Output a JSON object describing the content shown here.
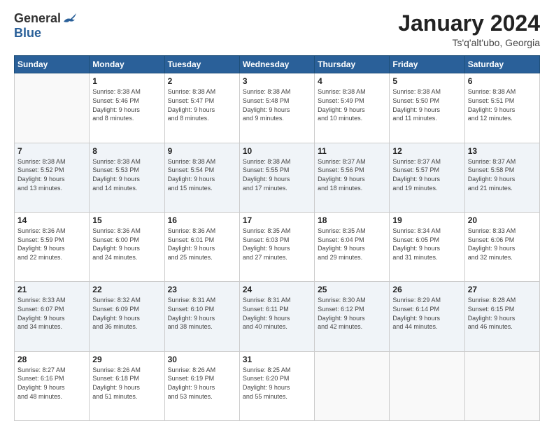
{
  "header": {
    "logo_general": "General",
    "logo_blue": "Blue",
    "month_title": "January 2024",
    "location": "Ts'q'alt'ubo, Georgia"
  },
  "weekdays": [
    "Sunday",
    "Monday",
    "Tuesday",
    "Wednesday",
    "Thursday",
    "Friday",
    "Saturday"
  ],
  "weeks": [
    [
      {
        "day": "",
        "info": ""
      },
      {
        "day": "1",
        "info": "Sunrise: 8:38 AM\nSunset: 5:46 PM\nDaylight: 9 hours\nand 8 minutes."
      },
      {
        "day": "2",
        "info": "Sunrise: 8:38 AM\nSunset: 5:47 PM\nDaylight: 9 hours\nand 8 minutes."
      },
      {
        "day": "3",
        "info": "Sunrise: 8:38 AM\nSunset: 5:48 PM\nDaylight: 9 hours\nand 9 minutes."
      },
      {
        "day": "4",
        "info": "Sunrise: 8:38 AM\nSunset: 5:49 PM\nDaylight: 9 hours\nand 10 minutes."
      },
      {
        "day": "5",
        "info": "Sunrise: 8:38 AM\nSunset: 5:50 PM\nDaylight: 9 hours\nand 11 minutes."
      },
      {
        "day": "6",
        "info": "Sunrise: 8:38 AM\nSunset: 5:51 PM\nDaylight: 9 hours\nand 12 minutes."
      }
    ],
    [
      {
        "day": "7",
        "info": "Sunrise: 8:38 AM\nSunset: 5:52 PM\nDaylight: 9 hours\nand 13 minutes."
      },
      {
        "day": "8",
        "info": "Sunrise: 8:38 AM\nSunset: 5:53 PM\nDaylight: 9 hours\nand 14 minutes."
      },
      {
        "day": "9",
        "info": "Sunrise: 8:38 AM\nSunset: 5:54 PM\nDaylight: 9 hours\nand 15 minutes."
      },
      {
        "day": "10",
        "info": "Sunrise: 8:38 AM\nSunset: 5:55 PM\nDaylight: 9 hours\nand 17 minutes."
      },
      {
        "day": "11",
        "info": "Sunrise: 8:37 AM\nSunset: 5:56 PM\nDaylight: 9 hours\nand 18 minutes."
      },
      {
        "day": "12",
        "info": "Sunrise: 8:37 AM\nSunset: 5:57 PM\nDaylight: 9 hours\nand 19 minutes."
      },
      {
        "day": "13",
        "info": "Sunrise: 8:37 AM\nSunset: 5:58 PM\nDaylight: 9 hours\nand 21 minutes."
      }
    ],
    [
      {
        "day": "14",
        "info": "Sunrise: 8:36 AM\nSunset: 5:59 PM\nDaylight: 9 hours\nand 22 minutes."
      },
      {
        "day": "15",
        "info": "Sunrise: 8:36 AM\nSunset: 6:00 PM\nDaylight: 9 hours\nand 24 minutes."
      },
      {
        "day": "16",
        "info": "Sunrise: 8:36 AM\nSunset: 6:01 PM\nDaylight: 9 hours\nand 25 minutes."
      },
      {
        "day": "17",
        "info": "Sunrise: 8:35 AM\nSunset: 6:03 PM\nDaylight: 9 hours\nand 27 minutes."
      },
      {
        "day": "18",
        "info": "Sunrise: 8:35 AM\nSunset: 6:04 PM\nDaylight: 9 hours\nand 29 minutes."
      },
      {
        "day": "19",
        "info": "Sunrise: 8:34 AM\nSunset: 6:05 PM\nDaylight: 9 hours\nand 31 minutes."
      },
      {
        "day": "20",
        "info": "Sunrise: 8:33 AM\nSunset: 6:06 PM\nDaylight: 9 hours\nand 32 minutes."
      }
    ],
    [
      {
        "day": "21",
        "info": "Sunrise: 8:33 AM\nSunset: 6:07 PM\nDaylight: 9 hours\nand 34 minutes."
      },
      {
        "day": "22",
        "info": "Sunrise: 8:32 AM\nSunset: 6:09 PM\nDaylight: 9 hours\nand 36 minutes."
      },
      {
        "day": "23",
        "info": "Sunrise: 8:31 AM\nSunset: 6:10 PM\nDaylight: 9 hours\nand 38 minutes."
      },
      {
        "day": "24",
        "info": "Sunrise: 8:31 AM\nSunset: 6:11 PM\nDaylight: 9 hours\nand 40 minutes."
      },
      {
        "day": "25",
        "info": "Sunrise: 8:30 AM\nSunset: 6:12 PM\nDaylight: 9 hours\nand 42 minutes."
      },
      {
        "day": "26",
        "info": "Sunrise: 8:29 AM\nSunset: 6:14 PM\nDaylight: 9 hours\nand 44 minutes."
      },
      {
        "day": "27",
        "info": "Sunrise: 8:28 AM\nSunset: 6:15 PM\nDaylight: 9 hours\nand 46 minutes."
      }
    ],
    [
      {
        "day": "28",
        "info": "Sunrise: 8:27 AM\nSunset: 6:16 PM\nDaylight: 9 hours\nand 48 minutes."
      },
      {
        "day": "29",
        "info": "Sunrise: 8:26 AM\nSunset: 6:18 PM\nDaylight: 9 hours\nand 51 minutes."
      },
      {
        "day": "30",
        "info": "Sunrise: 8:26 AM\nSunset: 6:19 PM\nDaylight: 9 hours\nand 53 minutes."
      },
      {
        "day": "31",
        "info": "Sunrise: 8:25 AM\nSunset: 6:20 PM\nDaylight: 9 hours\nand 55 minutes."
      },
      {
        "day": "",
        "info": ""
      },
      {
        "day": "",
        "info": ""
      },
      {
        "day": "",
        "info": ""
      }
    ]
  ]
}
